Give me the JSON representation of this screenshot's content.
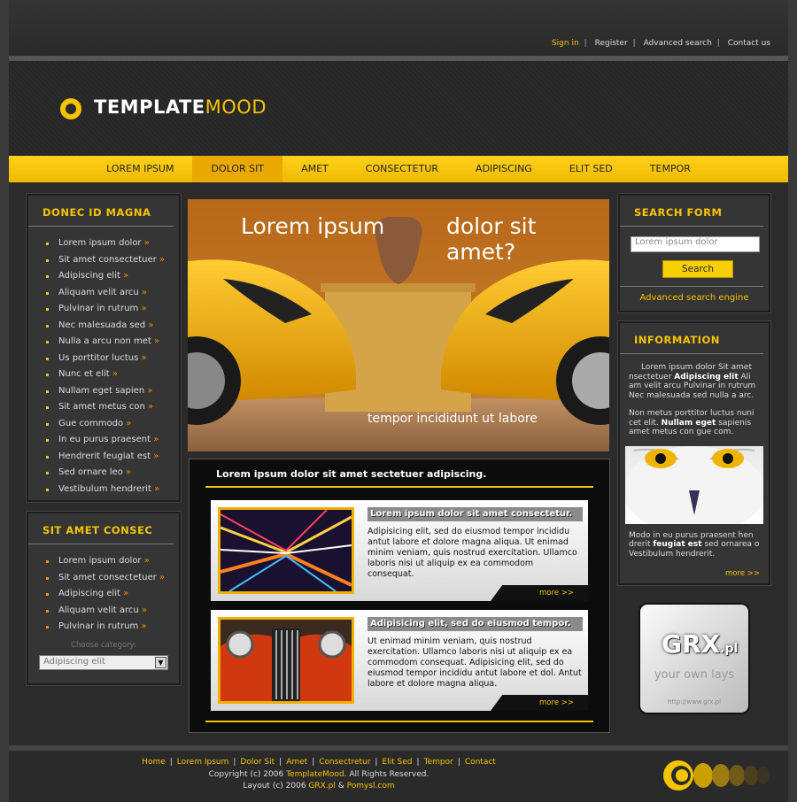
{
  "top_links": [
    {
      "label": "Sign in",
      "active": true
    },
    {
      "label": "Register",
      "active": false
    },
    {
      "label": "Advanced search",
      "active": false
    },
    {
      "label": "Contact us",
      "active": false
    }
  ],
  "logo": {
    "part1": "TEMPLATE",
    "part2": "MOOD"
  },
  "nav": [
    "LOREM IPSUM",
    "DOLOR SIT",
    "AMET",
    "CONSECTETUR",
    "ADIPISCING",
    "ELIT SED",
    "TEMPOR"
  ],
  "nav_active": 1,
  "left_panel_1": {
    "title": "DONEC ID MAGNA",
    "items": [
      "Lorem ipsum dolor",
      "Sit amet consectetuer",
      "Adipiscing elit",
      "Aliquam velit arcu",
      "Pulvinar in rutrum",
      "Nec malesuada sed",
      "Nulla a arcu non met",
      "Us porttitor luctus",
      "Nunc et elit",
      "Nullam eget sapien",
      "Sit amet metus con",
      "Gue commodo",
      "In eu purus praesent",
      "Hendrerit feugiat est",
      "Sed ornare leo",
      "Vestibulum hendrerit"
    ]
  },
  "left_panel_2": {
    "title": "SIT AMET CONSEC",
    "items": [
      "Lorem ipsum dolor",
      "Sit amet consectetuer",
      "Adipiscing elit",
      "Aliquam velit arcu",
      "Pulvinar in rutrum"
    ],
    "choose_label": "Choose category:",
    "select_value": "Adipiscing elit"
  },
  "hero": {
    "left_text": "Lorem ipsum",
    "right_text": "dolor sit amet?",
    "caption": "tempor incididunt ut labore"
  },
  "content": {
    "heading": "Lorem ipsum dolor sit amet sectetuer adipiscing.",
    "cards": [
      {
        "title": "Lorem ipsum dolor sit amet consectetur.",
        "text": "Adipisicing elit, sed do eiusmod tempor incididu antut labore et dolore magna aliqua. Ut enimad minim veniam, quis nostrud exercitation. Ullamco laboris nisi ut aliquip ex ea commodom consequat.",
        "more": "more >>"
      },
      {
        "title": "Adipisicing elit, sed do eiusmod tempor.",
        "text": "Ut enimad minim veniam, quis nostrud exercitation. Ullamco laboris nisi ut aliquip ex ea commodom consequat. Adipisicing elit, sed do eiusmod tempor incididu antut labore et dol. Antut labore et dolore magna aliqua.",
        "more": "more >>"
      }
    ]
  },
  "search": {
    "title": "SEARCH FORM",
    "placeholder": "Lorem ipsum dolor",
    "button": "Search",
    "advanced": "Advanced search engine"
  },
  "info": {
    "title": "INFORMATION",
    "p1_a": "Lorem ipsum dolor Sit amet nsectetuer ",
    "p1_b": "Adipiscing elit",
    "p1_c": " Ali am velit arcu Pulvinar in rutrum Nec malesuada sed nulla a arc.",
    "p2_a": "Non metus porttitor luctus nuni cet elit. ",
    "p2_b": "Nullam eget",
    "p2_c": " sapienis amet metus con gue com.",
    "p3_a": "Modo in eu purus praesent hen drerit ",
    "p3_b": "feugiat est",
    "p3_c": " sed ornarea o Vestibulum hendrerit.",
    "more": "more >>"
  },
  "badge": {
    "brand": "GRX",
    "tld": ".pl",
    "tagline": "your own lays",
    "url": "http://www.grx.pl"
  },
  "footer": {
    "links": [
      "Home",
      "Lorem Ipsum",
      "Dolor Sit",
      "Amet",
      "Consectretur",
      "Elit Sed",
      "Tempor",
      "Contact"
    ],
    "copyright_a": "Copyright (c) 2006 ",
    "copyright_b": "TemplateMood",
    "copyright_c": ". All Rights Reserved.",
    "layout_a": "Layout (c) 2006 ",
    "layout_b": "GRX.pl",
    "layout_c": " & ",
    "layout_d": "Pomysl.com"
  }
}
